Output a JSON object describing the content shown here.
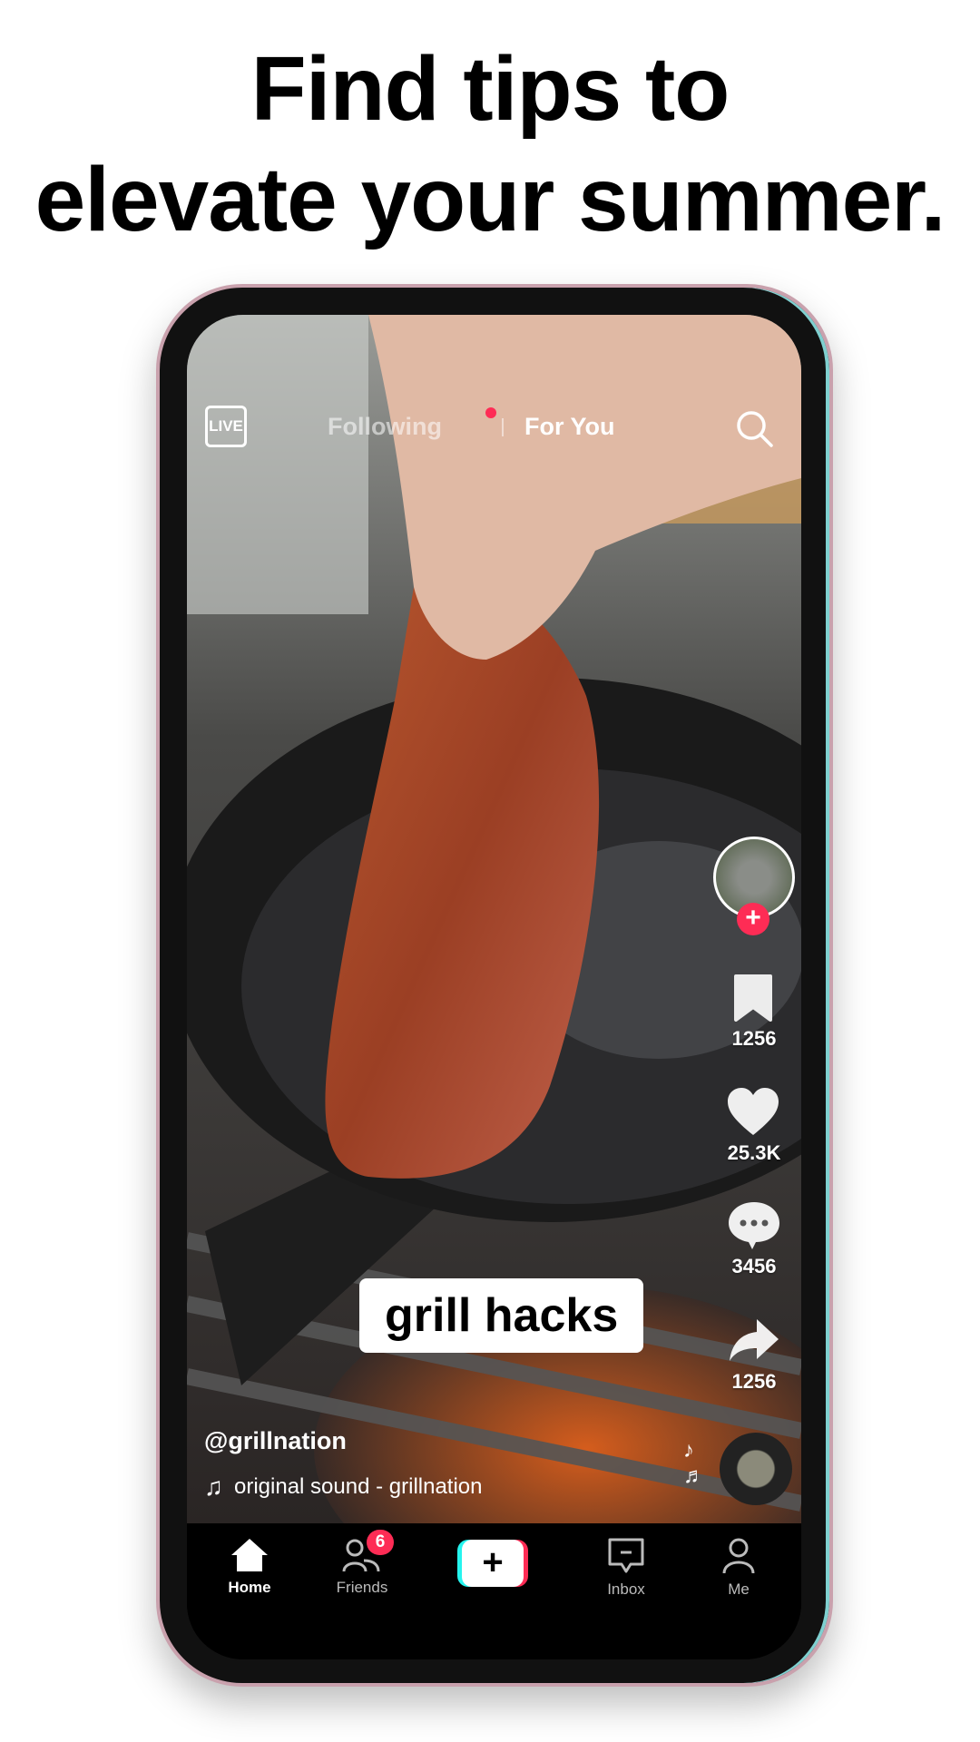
{
  "headline": {
    "line1": "Find tips to",
    "line2": "elevate your summer."
  },
  "feed": {
    "live_label": "LIVE",
    "tabs": [
      {
        "label": "Following",
        "active": false,
        "has_dot": true
      },
      {
        "label": "For You",
        "active": true
      }
    ],
    "caption": "grill hacks",
    "username": "@grillnation",
    "sound": "original sound - grillnation"
  },
  "rail": {
    "save_count": "1256",
    "like_count": "25.3K",
    "comment_count": "3456",
    "share_count": "1256"
  },
  "nav": {
    "items": [
      {
        "label": "Home",
        "icon": "home-icon",
        "active": true
      },
      {
        "label": "Friends",
        "icon": "friends-icon",
        "badge": "6"
      },
      {
        "label": "",
        "icon": "plus-icon"
      },
      {
        "label": "Inbox",
        "icon": "inbox-icon"
      },
      {
        "label": "Me",
        "icon": "profile-icon"
      }
    ]
  },
  "colors": {
    "accent": "#fe2c55",
    "cyan": "#25f4ee"
  }
}
